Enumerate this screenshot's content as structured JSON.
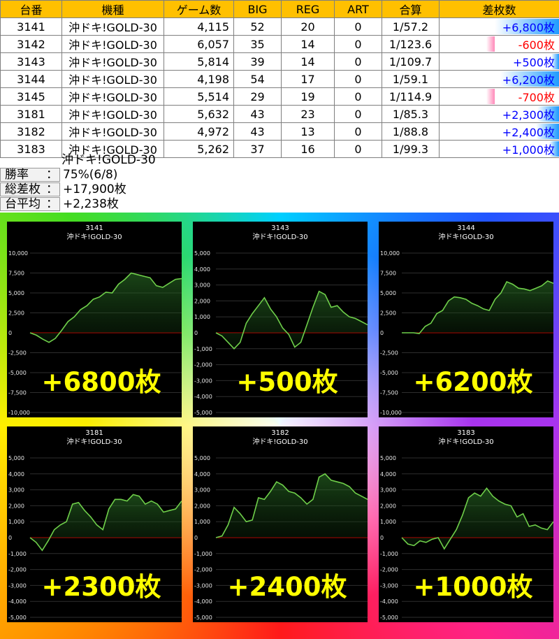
{
  "table": {
    "headers": [
      "台番",
      "機種",
      "ゲーム数",
      "BIG",
      "REG",
      "ART",
      "合算",
      "差枚数"
    ],
    "rows": [
      {
        "no": "3141",
        "model": "沖ドキ!GOLD-30",
        "games": "4,115",
        "big": "52",
        "reg": "20",
        "art": "0",
        "combined": "1/57.2",
        "diff": "+6,800枚",
        "diff_value": 6800
      },
      {
        "no": "3142",
        "model": "沖ドキ!GOLD-30",
        "games": "6,057",
        "big": "35",
        "reg": "14",
        "art": "0",
        "combined": "1/123.6",
        "diff": "-600枚",
        "diff_value": -600
      },
      {
        "no": "3143",
        "model": "沖ドキ!GOLD-30",
        "games": "5,814",
        "big": "39",
        "reg": "14",
        "art": "0",
        "combined": "1/109.7",
        "diff": "+500枚",
        "diff_value": 500
      },
      {
        "no": "3144",
        "model": "沖ドキ!GOLD-30",
        "games": "4,198",
        "big": "54",
        "reg": "17",
        "art": "0",
        "combined": "1/59.1",
        "diff": "+6,200枚",
        "diff_value": 6200
      },
      {
        "no": "3145",
        "model": "沖ドキ!GOLD-30",
        "games": "5,514",
        "big": "29",
        "reg": "19",
        "art": "0",
        "combined": "1/114.9",
        "diff": "-700枚",
        "diff_value": -700
      },
      {
        "no": "3181",
        "model": "沖ドキ!GOLD-30",
        "games": "5,632",
        "big": "43",
        "reg": "23",
        "art": "0",
        "combined": "1/85.3",
        "diff": "+2,300枚",
        "diff_value": 2300
      },
      {
        "no": "3182",
        "model": "沖ドキ!GOLD-30",
        "games": "4,972",
        "big": "43",
        "reg": "13",
        "art": "0",
        "combined": "1/88.8",
        "diff": "+2,400枚",
        "diff_value": 2400
      },
      {
        "no": "3183",
        "model": "沖ドキ!GOLD-30",
        "games": "5,262",
        "big": "37",
        "reg": "16",
        "art": "0",
        "combined": "1/99.3",
        "diff": "+1,000枚",
        "diff_value": 1000
      }
    ]
  },
  "summary": {
    "model": "沖ドキ!GOLD-30",
    "win_rate_label": "勝率",
    "win_rate": "75%(6/8)",
    "total_label": "総差枚",
    "total": "+17,900枚",
    "avg_label": "台平均",
    "avg": "+2,238枚",
    "colon": "："
  },
  "colors": {
    "header": "#ffc000",
    "positive": "#0000ff",
    "negative": "#ff0000",
    "graph_line": "#6fcf4a",
    "zero_line": "#cc0000",
    "big_text": "#ffff00"
  },
  "chart_data": [
    {
      "type": "area",
      "title": "3141",
      "subtitle": "沖ドキ!GOLD-30",
      "ylim": [
        -10000,
        10000
      ],
      "yticks": [
        "10,000",
        "7,500",
        "5,000",
        "2,500",
        "0",
        "-2,500",
        "-5,000",
        "-7,500",
        "-10,000"
      ],
      "y": [
        0,
        -300,
        -800,
        -1200,
        -700,
        300,
        1400,
        2000,
        2900,
        3400,
        4200,
        4500,
        5100,
        5000,
        6100,
        6700,
        7500,
        7300,
        7100,
        6900,
        5900,
        5700,
        6200,
        6700,
        6800
      ],
      "big_label": "+6800枚"
    },
    {
      "type": "area",
      "title": "3143",
      "subtitle": "沖ドキ!GOLD-30",
      "ylim": [
        -5000,
        5000
      ],
      "yticks": [
        "5,000",
        "4,000",
        "3,000",
        "2,000",
        "1,000",
        "0",
        "-1,000",
        "-2,000",
        "-3,000",
        "-4,000",
        "-5,000"
      ],
      "y": [
        0,
        -200,
        -600,
        -1000,
        -600,
        600,
        1200,
        1700,
        2200,
        1500,
        1000,
        300,
        -100,
        -900,
        -600,
        500,
        1600,
        2600,
        2400,
        1600,
        1700,
        1300,
        1000,
        900,
        700,
        500
      ],
      "big_label": "+500枚"
    },
    {
      "type": "area",
      "title": "3144",
      "subtitle": "沖ドキ!GOLD-30",
      "ylim": [
        -10000,
        10000
      ],
      "yticks": [
        "10,000",
        "7,500",
        "5,000",
        "2,500",
        "0",
        "-2,500",
        "-5,000",
        "-7,500",
        "-10,000"
      ],
      "y": [
        0,
        0,
        0,
        -100,
        800,
        1200,
        2400,
        2800,
        4000,
        4500,
        4400,
        4200,
        3700,
        3400,
        3000,
        2800,
        4200,
        5000,
        6400,
        6100,
        5600,
        5500,
        5300,
        5600,
        5900,
        6500,
        6200
      ],
      "big_label": "+6200枚"
    },
    {
      "type": "area",
      "title": "3181",
      "subtitle": "沖ドキ!GOLD-30",
      "ylim": [
        -5000,
        5000
      ],
      "yticks": [
        "5,000",
        "4,000",
        "3,000",
        "2,000",
        "1,000",
        "0",
        "-1,000",
        "-2,000",
        "-3,000",
        "-4,000",
        "-5,000"
      ],
      "y": [
        0,
        -300,
        -800,
        -200,
        500,
        800,
        1000,
        2100,
        2200,
        1700,
        1300,
        800,
        500,
        1800,
        2400,
        2400,
        2300,
        2700,
        2600,
        2100,
        2300,
        2100,
        1600,
        1700,
        1800,
        2300
      ],
      "big_label": "+2300枚"
    },
    {
      "type": "area",
      "title": "3182",
      "subtitle": "沖ドキ!GOLD-30",
      "ylim": [
        -5000,
        5000
      ],
      "yticks": [
        "5,000",
        "4,000",
        "3,000",
        "2,000",
        "1,000",
        "0",
        "-1,000",
        "-2,000",
        "-3,000",
        "-4,000",
        "-5,000"
      ],
      "y": [
        0,
        100,
        800,
        1900,
        1500,
        1000,
        1100,
        2500,
        2400,
        2900,
        3500,
        3300,
        2900,
        2800,
        2500,
        2100,
        2400,
        3800,
        4000,
        3600,
        3500,
        3400,
        3200,
        2800,
        2600,
        2400
      ],
      "big_label": "+2400枚"
    },
    {
      "type": "area",
      "title": "3183",
      "subtitle": "沖ドキ!GOLD-30",
      "ylim": [
        -5000,
        5000
      ],
      "yticks": [
        "5,000",
        "4,000",
        "3,000",
        "2,000",
        "1,000",
        "0",
        "-1,000",
        "-2,000",
        "-3,000",
        "-4,000",
        "-5,000"
      ],
      "y": [
        0,
        -400,
        -500,
        -200,
        -300,
        -100,
        0,
        -700,
        -100,
        500,
        1400,
        2500,
        2800,
        2600,
        3100,
        2600,
        2300,
        2100,
        2000,
        1300,
        1500,
        700,
        800,
        600,
        500,
        1000
      ],
      "big_label": "+1000枚"
    }
  ]
}
